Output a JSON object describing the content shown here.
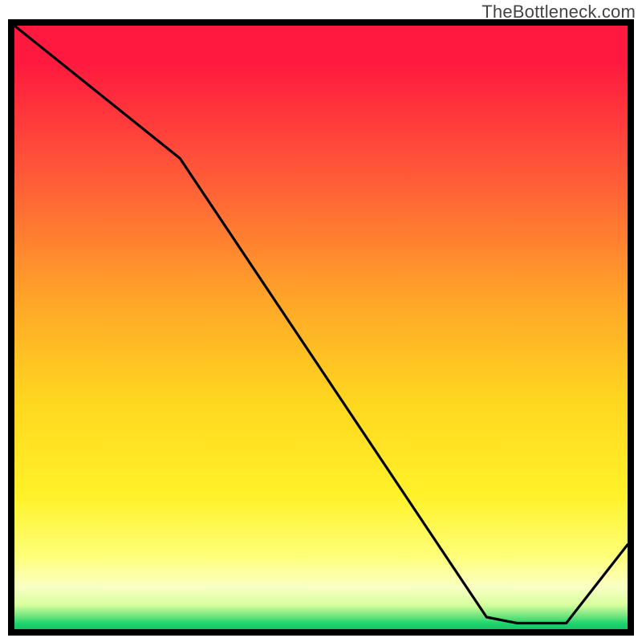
{
  "watermark": "TheBottleneck.com",
  "annotation": "",
  "chart_data": {
    "type": "line",
    "title": "",
    "xlabel": "",
    "ylabel": "",
    "xlim": [
      0,
      100
    ],
    "ylim": [
      0,
      100
    ],
    "x": [
      0,
      27,
      77,
      82,
      90,
      100
    ],
    "values": [
      100,
      78,
      2,
      1,
      1,
      14
    ],
    "gradient_stops": [
      {
        "pct": 0,
        "color": "#ff193f"
      },
      {
        "pct": 25,
        "color": "#ff5a38"
      },
      {
        "pct": 45,
        "color": "#ffa429"
      },
      {
        "pct": 62,
        "color": "#ffd61f"
      },
      {
        "pct": 78,
        "color": "#fff22a"
      },
      {
        "pct": 93,
        "color": "#faffc4"
      },
      {
        "pct": 98,
        "color": "#66e27a"
      },
      {
        "pct": 100,
        "color": "#16c466"
      }
    ],
    "annotation": {
      "x": 82,
      "y": 1,
      "text": ""
    }
  }
}
